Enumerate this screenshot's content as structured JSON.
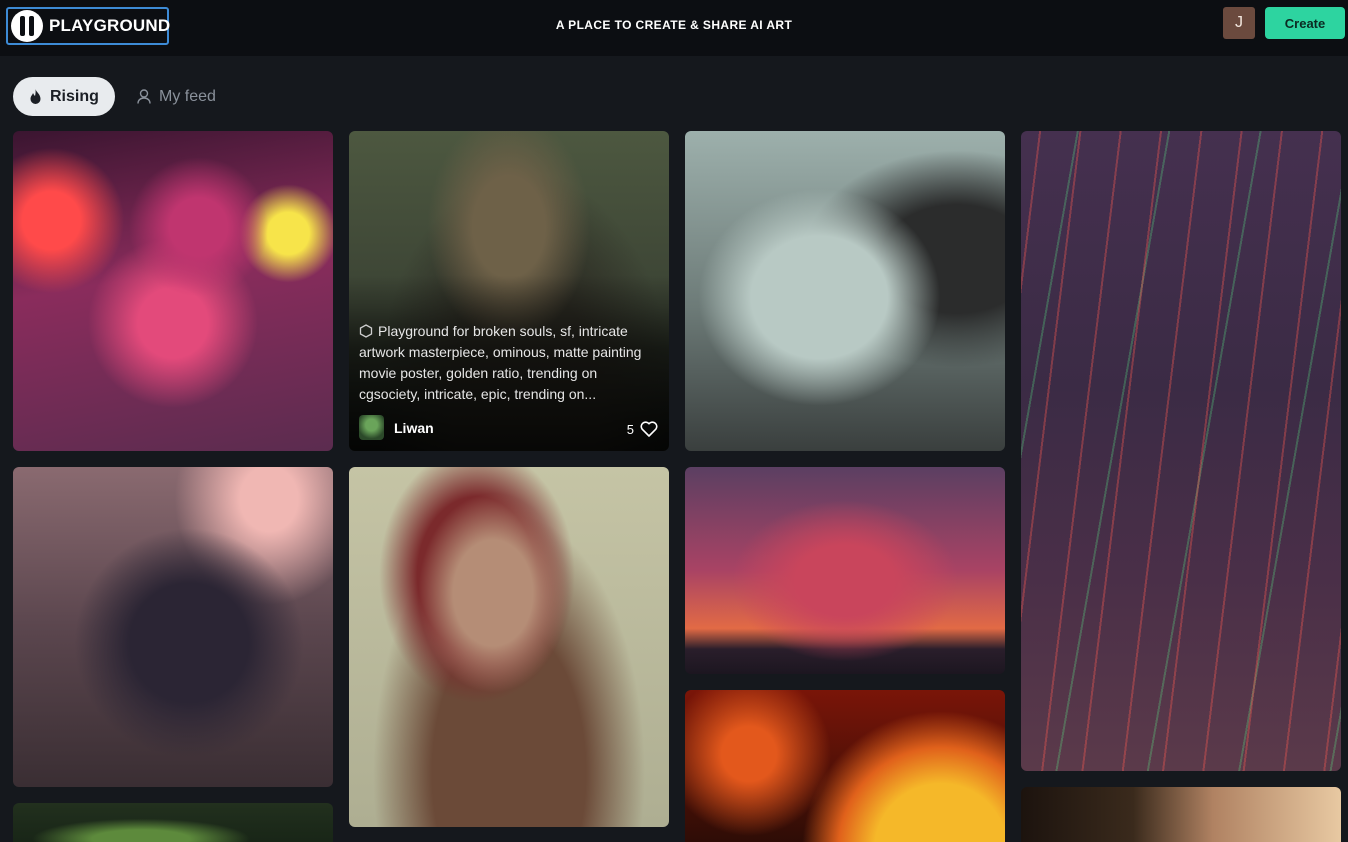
{
  "header": {
    "logo_text": "PLAYGROUND",
    "tagline": "A PLACE TO CREATE & SHARE AI ART",
    "avatar_initial": "J",
    "create_label": "Create"
  },
  "tabs": [
    {
      "label": "Rising",
      "icon": "flame-icon",
      "active": true
    },
    {
      "label": "My feed",
      "icon": "user-icon",
      "active": false
    }
  ],
  "gallery": {
    "featured": {
      "prompt": "Playground for broken souls, sf, intricate artwork masterpiece, ominous, matte painting movie poster, golden ratio, trending on cgsociety, intricate, epic, trending on...",
      "author": "Liwan",
      "likes": "5"
    }
  },
  "colors": {
    "accent": "#2dd4a0",
    "logo_border": "#3d8bd6",
    "background": "#15181d",
    "header_bg": "#0c0e12"
  }
}
